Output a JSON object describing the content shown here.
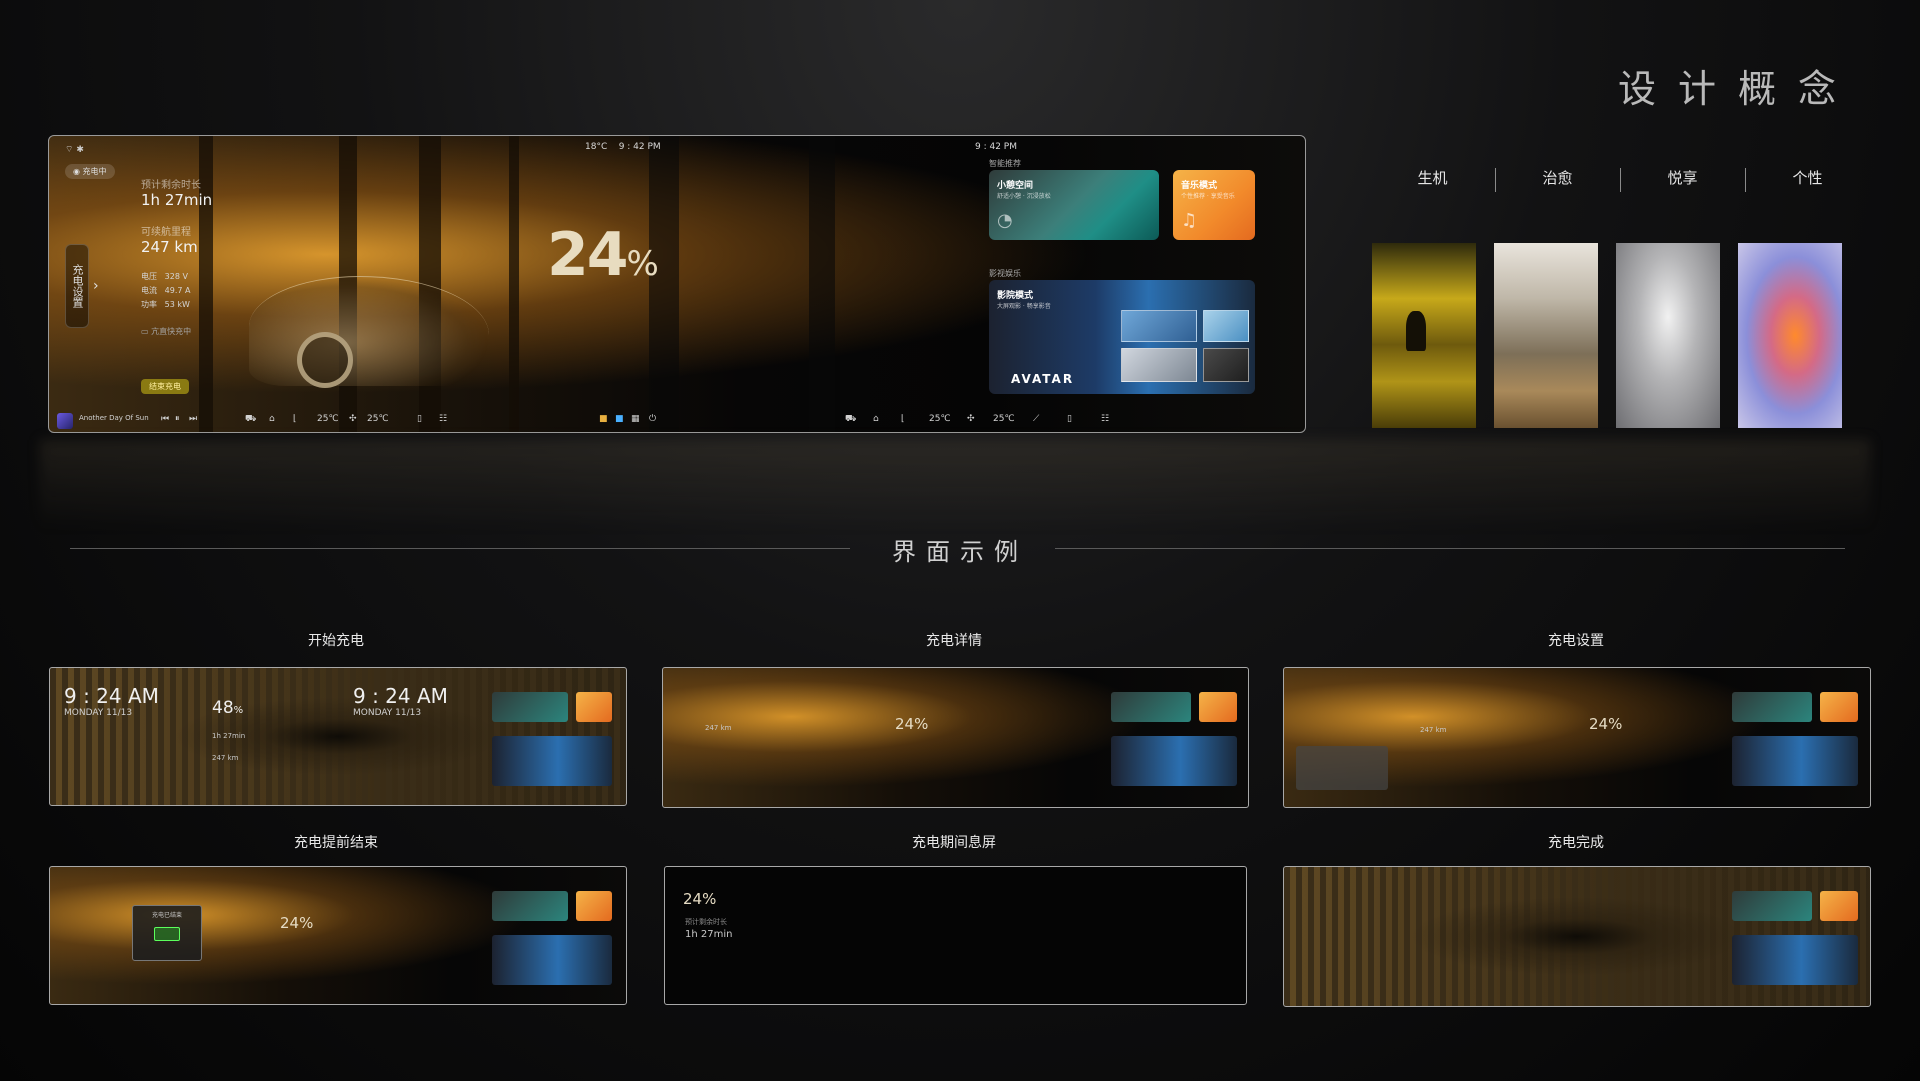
{
  "header": {
    "concept_title": "设计概念",
    "moods": [
      "生机",
      "治愈",
      "悦享",
      "个性"
    ],
    "thumbnails": [
      "deer-forest-image",
      "misty-forest-image",
      "smoke-image",
      "glow-figure-image"
    ]
  },
  "main_screen": {
    "temperature": "18°C",
    "time_center": "9 : 42 PM",
    "time_right": "9 : 42 PM",
    "charging_chip": "充电中",
    "side_tab": "充电设置",
    "remaining_label": "预计剩余时长",
    "remaining_value": "1h  27min",
    "range_label": "可续航里程",
    "range_value": "247 km",
    "voltage_label": "电压",
    "voltage_value": "328 V",
    "current_label": "电流",
    "current_value": "49.7 A",
    "power_label": "功率",
    "power_value": "53 kW",
    "status_text": "亢直快充中",
    "end_button": "结束充电",
    "battery_percent": "24",
    "percent_sign": "%",
    "smart_recommend": "智能推荐",
    "space_card_title": "小憩空间",
    "space_card_sub": "舒适小憩 · 沉浸放松",
    "music_card_title": "音乐模式",
    "music_card_sub": "个性推荐 · 享受音乐",
    "video_section": "影视娱乐",
    "movie_card_title": "影院模式",
    "movie_card_sub": "大屏观影 · 畅享影音",
    "movie_name": "AVATAR",
    "song": "Another Day Of Sun",
    "dock_temp_left": "25℃",
    "dock_temp_right": "25℃",
    "icon_colors": {
      "accent": "#e8b040",
      "end_button": "#8a7a12",
      "music_card": "#f28a2b",
      "space_card": "#2c857d"
    }
  },
  "examples_title": "界面示例",
  "examples": [
    {
      "label": "开始充电",
      "time": "9 : 24 AM",
      "date": "MONDAY  11/13",
      "percent": "48",
      "remaining": "1h  27min",
      "range": "247 km"
    },
    {
      "label": "充电详情",
      "percent": "24",
      "range": "247 km"
    },
    {
      "label": "充电设置",
      "percent": "24",
      "range": "247 km"
    },
    {
      "label": "充电提前结束",
      "percent": "24",
      "popup": "充电已结束"
    },
    {
      "label": "充电期间息屏",
      "percent": "24",
      "remaining_label": "预计剩余时长",
      "remaining": "1h  27min"
    },
    {
      "label": "充电完成"
    }
  ]
}
